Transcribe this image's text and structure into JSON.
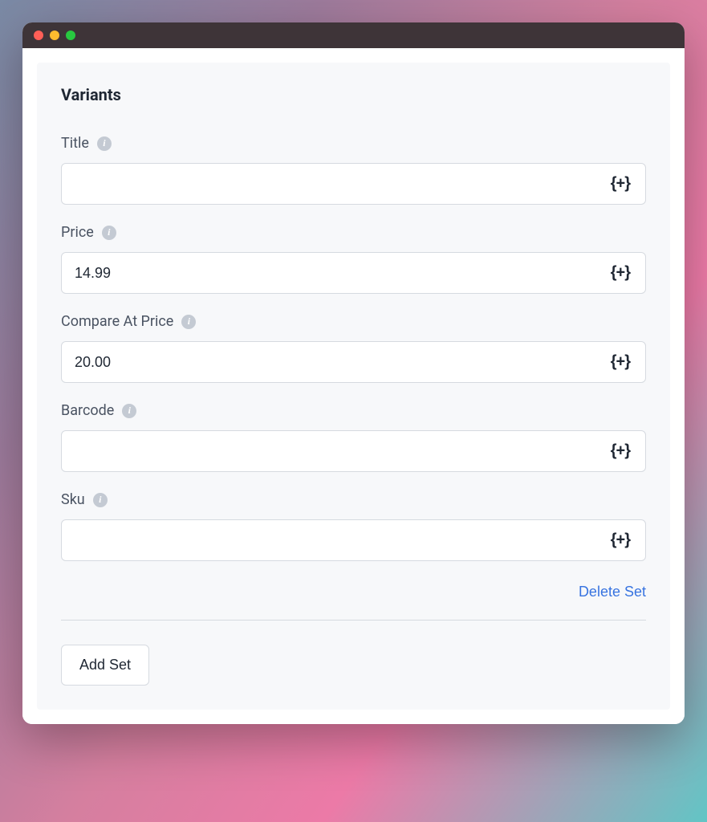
{
  "panel": {
    "title": "Variants"
  },
  "fields": {
    "title": {
      "label": "Title",
      "value": "",
      "insert_var_label": "{+}"
    },
    "price": {
      "label": "Price",
      "value": "14.99",
      "insert_var_label": "{+}"
    },
    "compare_at_price": {
      "label": "Compare At Price",
      "value": "20.00",
      "insert_var_label": "{+}"
    },
    "barcode": {
      "label": "Barcode",
      "value": "",
      "insert_var_label": "{+}"
    },
    "sku": {
      "label": "Sku",
      "value": "",
      "insert_var_label": "{+}"
    }
  },
  "actions": {
    "delete_set": "Delete Set",
    "add_set": "Add Set"
  },
  "icons": {
    "info_glyph": "i"
  }
}
